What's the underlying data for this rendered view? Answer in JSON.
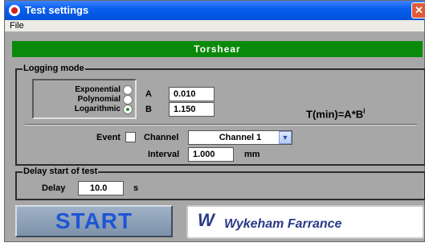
{
  "window": {
    "title": "Test settings",
    "close_glyph": "✕",
    "menu": [
      "File"
    ],
    "banner": "Torshear"
  },
  "logging_mode": {
    "group_title": "Logging mode",
    "options": [
      {
        "label": "Exponential",
        "selected": false
      },
      {
        "label": "Polynomial",
        "selected": false
      },
      {
        "label": "Logarithmic",
        "selected": true
      }
    ],
    "A_label": "A",
    "A_value": "0.010",
    "B_label": "B",
    "B_value": "1.150",
    "formula": "T(min)=A*B",
    "formula_exponent": "i",
    "event_label": "Event",
    "event_checked": false,
    "channel_label": "Channel",
    "channel_value": "Channel 1",
    "interval_label": "Interval",
    "interval_value": "1.000",
    "interval_unit": "mm"
  },
  "delay": {
    "group_title": "Delay start of test",
    "label": "Delay",
    "value": "10.0",
    "unit": "s"
  },
  "start_button": "START",
  "logo": {
    "mark": "W",
    "text": "Wykeham Farrance"
  },
  "colors": {
    "titlebar": "#0a5ff0",
    "banner": "#0a8a0a",
    "panel": "#a7a7a7",
    "start_text": "#1d56d6",
    "logo_text": "#2b3a86"
  },
  "icons": {
    "title": "app-icon",
    "close": "close-icon",
    "dropdown": "chevron-down-icon"
  }
}
